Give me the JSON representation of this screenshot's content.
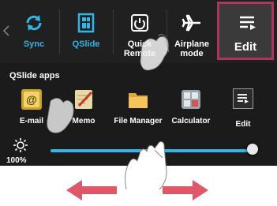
{
  "quick_settings": {
    "items": [
      {
        "label": "Sync",
        "icon": "sync-icon",
        "color": "#33b5e5"
      },
      {
        "label": "QSlide",
        "icon": "qslide-icon",
        "color": "#33b5e5"
      },
      {
        "label": "Quick Remote",
        "icon": "power-icon",
        "color": "#ffffff"
      },
      {
        "label": "Airplane mode",
        "icon": "airplane-icon",
        "color": "#ffffff"
      }
    ],
    "edit_label": "Edit",
    "highlight_color": "#b0345a"
  },
  "qslide": {
    "title": "QSlide apps",
    "apps": [
      {
        "label": "E-mail",
        "icon": "email-icon"
      },
      {
        "label": "Memo",
        "icon": "memo-icon"
      },
      {
        "label": "File Manager",
        "icon": "folder-icon"
      },
      {
        "label": "Calculator",
        "icon": "calculator-icon"
      }
    ],
    "edit_label": "Edit"
  },
  "brightness": {
    "label": "100%",
    "level": 1.0
  },
  "colors": {
    "accent": "#33b5e5",
    "panel": "#1b1b1b",
    "swipe_arrow": "#e0576a"
  }
}
